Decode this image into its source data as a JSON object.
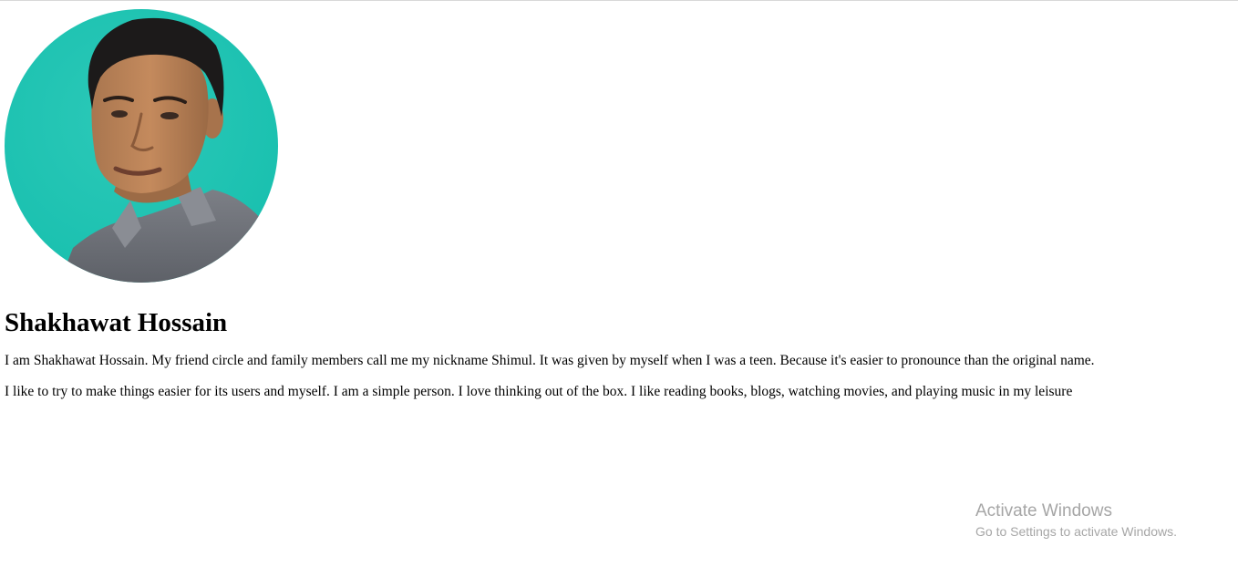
{
  "profile": {
    "name": "Shakhawat Hossain",
    "paragraphs": [
      "I am Shakhawat Hossain. My friend circle and family members call me my nickname Shimul. It was given by myself when I was a teen. Because it's easier to pronounce than the original name.",
      "I like to try to make things easier for its users and myself. I am a simple person. I love thinking out of the box. I like reading books, blogs, watching movies, and playing music in my leisure"
    ],
    "avatar_background": "#1fc4b4"
  },
  "watermark": {
    "title": "Activate Windows",
    "subtitle": "Go to Settings to activate Windows."
  }
}
